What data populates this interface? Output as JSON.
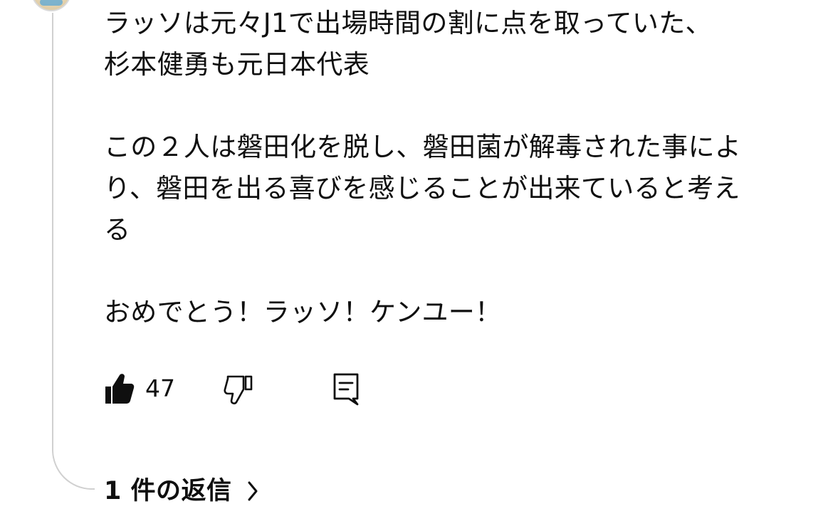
{
  "comment": {
    "text": "ラッソは元々J1で出場時間の割に点を取っていた、\n杉本健勇も元日本代表\n\nこの２人は磐田化を脱し、磐田菌が解毒された事によ\nり、磐田を出る喜びを感じることが出来ていると考え\nる\n\nおめでとう！ラッソ！ケンユー！",
    "likes": "47",
    "icons": {
      "like": "thumbs-up-filled-icon",
      "dislike": "thumbs-down-outline-icon",
      "reply": "comment-reply-icon"
    }
  },
  "replies": {
    "label": "1 件の返信",
    "icon": "chevron-right-icon"
  },
  "colors": {
    "text": "#0f0f0f",
    "thread_line": "#d0d0d0",
    "background": "#ffffff"
  }
}
